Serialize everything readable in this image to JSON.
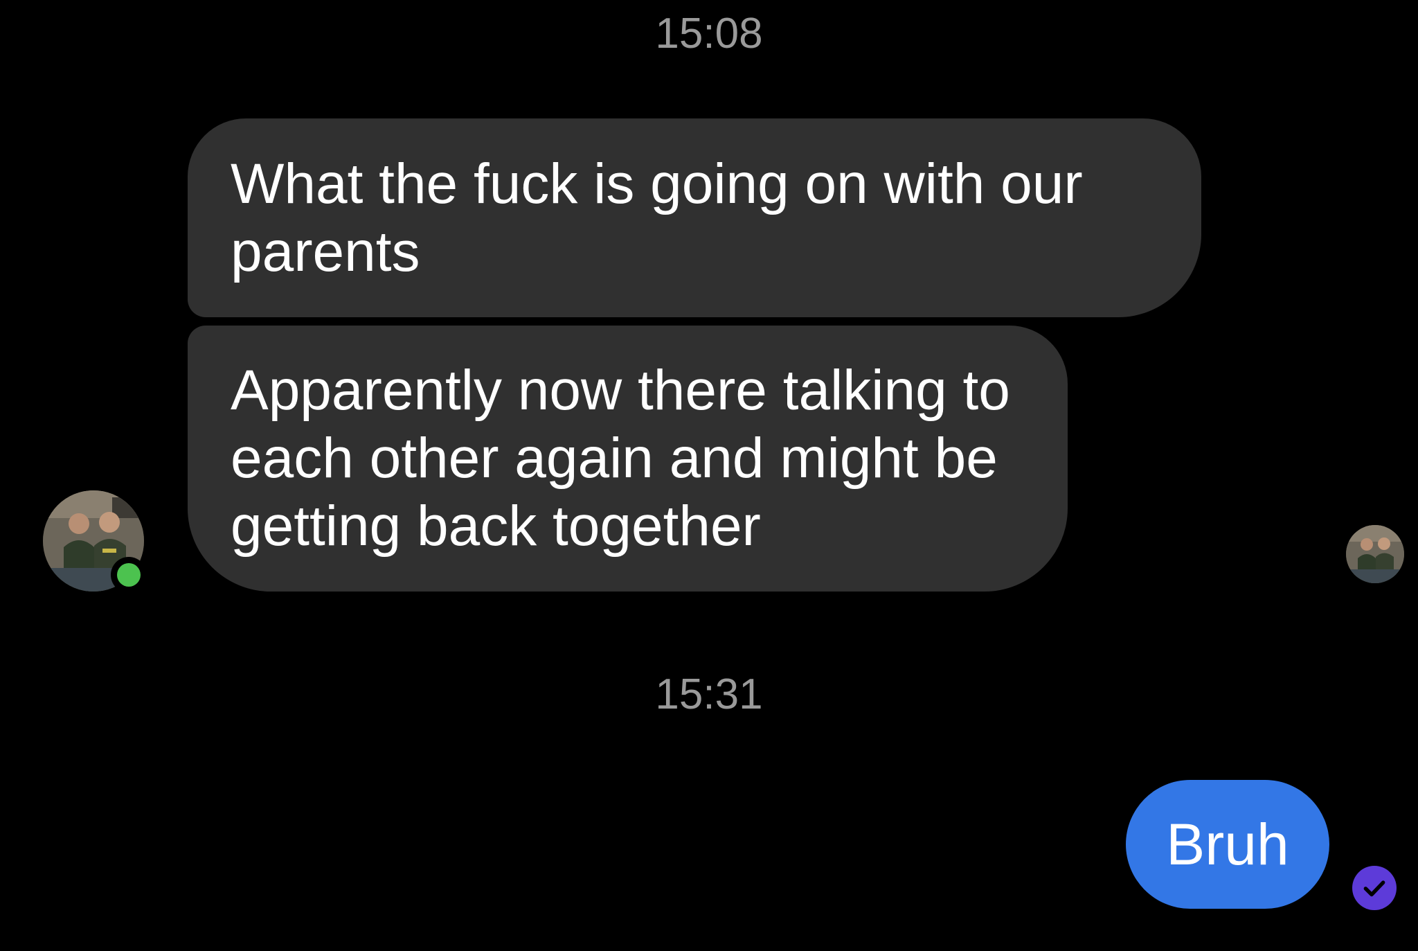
{
  "conversation": {
    "timestamps": [
      "15:08",
      "15:31"
    ],
    "incoming": [
      {
        "text": "What the fuck is going on with our parents"
      },
      {
        "text": "Apparently now there talking to each other again and might be getting back together"
      }
    ],
    "outgoing": [
      {
        "text": "Bruh"
      }
    ]
  },
  "icons": {
    "sender_avatar": "avatar-photo-icon",
    "seen_avatar": "avatar-photo-icon",
    "presence": "online-status-icon",
    "receipt": "check-icon"
  },
  "colors": {
    "background": "#000000",
    "incoming_bubble": "#303030",
    "outgoing_bubble": "#3377e6",
    "timestamp_text": "#9a9a9a",
    "online": "#4cc24f",
    "receipt": "#5d3bd9"
  }
}
